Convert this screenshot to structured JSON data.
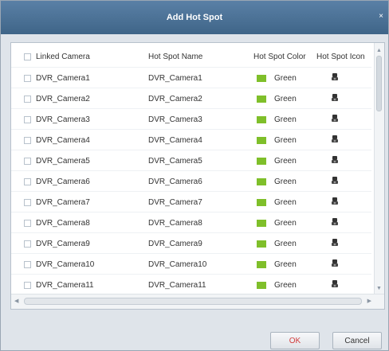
{
  "dialog": {
    "title": "Add Hot Spot",
    "close_glyph": "×"
  },
  "table": {
    "columns": {
      "linked_camera": "Linked Camera",
      "hot_spot_name": "Hot Spot Name",
      "hot_spot_color": "Hot Spot Color",
      "hot_spot_icon": "Hot Spot Icon"
    },
    "rows": [
      {
        "camera": "DVR_Camera1",
        "name": "DVR_Camera1",
        "color": "Green",
        "icon": "camera-icon"
      },
      {
        "camera": "DVR_Camera2",
        "name": "DVR_Camera2",
        "color": "Green",
        "icon": "camera-icon"
      },
      {
        "camera": "DVR_Camera3",
        "name": "DVR_Camera3",
        "color": "Green",
        "icon": "camera-icon"
      },
      {
        "camera": "DVR_Camera4",
        "name": "DVR_Camera4",
        "color": "Green",
        "icon": "camera-icon"
      },
      {
        "camera": "DVR_Camera5",
        "name": "DVR_Camera5",
        "color": "Green",
        "icon": "camera-icon"
      },
      {
        "camera": "DVR_Camera6",
        "name": "DVR_Camera6",
        "color": "Green",
        "icon": "camera-icon"
      },
      {
        "camera": "DVR_Camera7",
        "name": "DVR_Camera7",
        "color": "Green",
        "icon": "camera-icon"
      },
      {
        "camera": "DVR_Camera8",
        "name": "DVR_Camera8",
        "color": "Green",
        "icon": "camera-icon"
      },
      {
        "camera": "DVR_Camera9",
        "name": "DVR_Camera9",
        "color": "Green",
        "icon": "camera-icon"
      },
      {
        "camera": "DVR_Camera10",
        "name": "DVR_Camera10",
        "color": "Green",
        "icon": "camera-icon"
      },
      {
        "camera": "DVR_Camera11",
        "name": "DVR_Camera11",
        "color": "Green",
        "icon": "camera-icon"
      }
    ]
  },
  "buttons": {
    "ok": "OK",
    "cancel": "Cancel"
  },
  "colors": {
    "title_bar": "#4a7096",
    "swatch_green": "#7fbf2a",
    "ok_text": "#d23c3c"
  }
}
